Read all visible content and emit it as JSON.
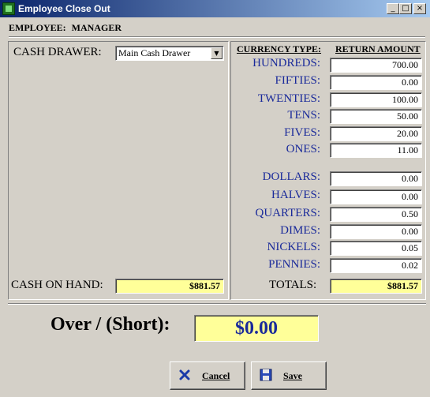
{
  "window": {
    "title": "Employee Close Out",
    "minimize_glyph": "_",
    "maximize_glyph": "□",
    "close_glyph": "×"
  },
  "employee": {
    "label": "EMPLOYEE:",
    "name": "MANAGER"
  },
  "cash_drawer": {
    "label": "CASH DRAWER:",
    "selected": "Main Cash Drawer"
  },
  "cash_on_hand": {
    "label": "CASH ON HAND:",
    "value": "$881.57"
  },
  "headers": {
    "currency_type": "CURRENCY TYPE:",
    "return_amount": "RETURN AMOUNT"
  },
  "bills": [
    {
      "label": "HUNDREDS:",
      "value": "700.00"
    },
    {
      "label": "FIFTIES:",
      "value": "0.00"
    },
    {
      "label": "TWENTIES:",
      "value": "100.00"
    },
    {
      "label": "TENS:",
      "value": "50.00"
    },
    {
      "label": "FIVES:",
      "value": "20.00"
    },
    {
      "label": "ONES:",
      "value": "11.00"
    }
  ],
  "coins": [
    {
      "label": "DOLLARS:",
      "value": "0.00"
    },
    {
      "label": "HALVES:",
      "value": "0.00"
    },
    {
      "label": "QUARTERS:",
      "value": "0.50"
    },
    {
      "label": "DIMES:",
      "value": "0.00"
    },
    {
      "label": "NICKELS:",
      "value": "0.05"
    },
    {
      "label": "PENNIES:",
      "value": "0.02"
    }
  ],
  "totals": {
    "label": "TOTALS:",
    "value": "$881.57"
  },
  "over_short": {
    "label": "Over / (Short):",
    "value": "$0.00"
  },
  "buttons": {
    "cancel": "Cancel",
    "save": "Save"
  },
  "colors": {
    "title_bar": "#0a246a",
    "highlight": "#ffff99",
    "label_blue": "#1a2a9a",
    "face": "#d4d0c8"
  }
}
